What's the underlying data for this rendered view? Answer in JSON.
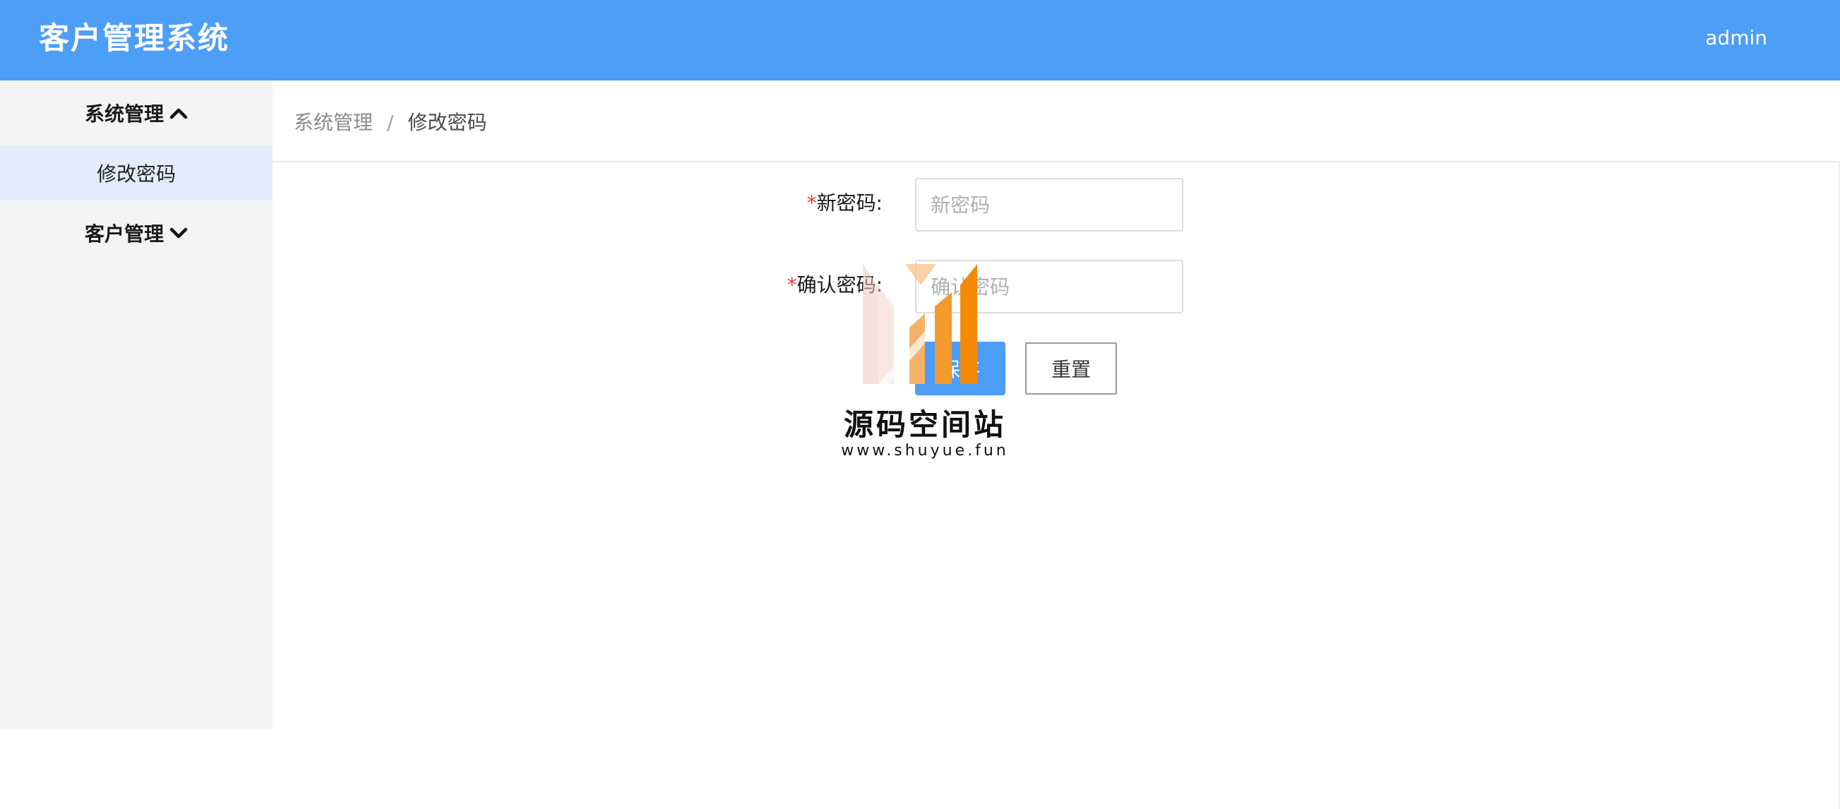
{
  "header": {
    "app_title": "客户管理系统",
    "username": "admin"
  },
  "sidebar": {
    "groups": [
      {
        "label": "系统管理",
        "expanded": true,
        "icon": "chevron-up-icon",
        "items": [
          {
            "label": "修改密码",
            "active": true
          }
        ]
      },
      {
        "label": "客户管理",
        "expanded": false,
        "icon": "chevron-down-icon",
        "items": []
      }
    ]
  },
  "breadcrumb": {
    "parent": "系统管理",
    "separator": "/",
    "current": "修改密码"
  },
  "form": {
    "required_mark": "*",
    "new_password": {
      "label": "新密码:",
      "placeholder": "新密码",
      "value": ""
    },
    "confirm_password": {
      "label": "确认密码:",
      "placeholder": "确认密码",
      "value": ""
    },
    "submit_label": "保存",
    "reset_label": "重置"
  },
  "watermark": {
    "title": "源码空间站",
    "url": "www.shuyue.fun"
  },
  "colors": {
    "header_bg": "#4d9ef7",
    "sidebar_bg": "#f4f4f5",
    "active_item_bg": "#e3ecfa",
    "required_mark": "#e23d3d",
    "watermark_orange": "#f58a07"
  }
}
